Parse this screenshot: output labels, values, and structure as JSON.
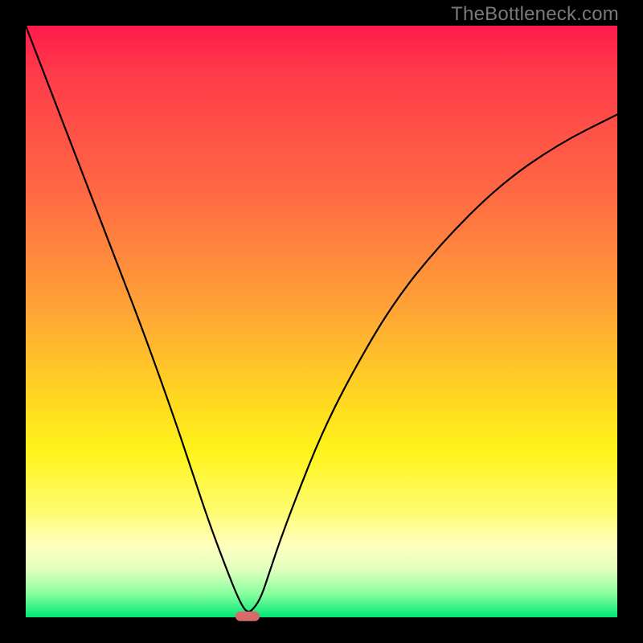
{
  "watermark": "TheBottleneck.com",
  "chart_data": {
    "type": "line",
    "title": "",
    "xlabel": "",
    "ylabel": "",
    "xlim": [
      0,
      100
    ],
    "ylim": [
      0,
      100
    ],
    "grid": false,
    "legend": false,
    "series": [
      {
        "name": "bottleneck-curve",
        "x": [
          0,
          5,
          10,
          15,
          20,
          25,
          28,
          31,
          34,
          36,
          37.5,
          39,
          40,
          41,
          43,
          46,
          50,
          55,
          62,
          70,
          80,
          90,
          100
        ],
        "values": [
          100,
          87,
          74,
          61,
          48,
          34,
          25,
          16,
          8,
          3,
          0.5,
          2,
          4,
          7,
          13,
          21,
          31,
          41,
          53,
          63,
          73,
          80,
          85
        ]
      }
    ],
    "annotations": [
      {
        "type": "min-marker",
        "x": 37.5,
        "y": 0,
        "color": "#d86a6a"
      }
    ],
    "gradient_stops": [
      {
        "pos": 0,
        "color": "#ff1a4d"
      },
      {
        "pos": 28,
        "color": "#ff6844"
      },
      {
        "pos": 62,
        "color": "#ffd422"
      },
      {
        "pos": 88,
        "color": "#ffffc0"
      },
      {
        "pos": 100,
        "color": "#00e676"
      }
    ]
  }
}
